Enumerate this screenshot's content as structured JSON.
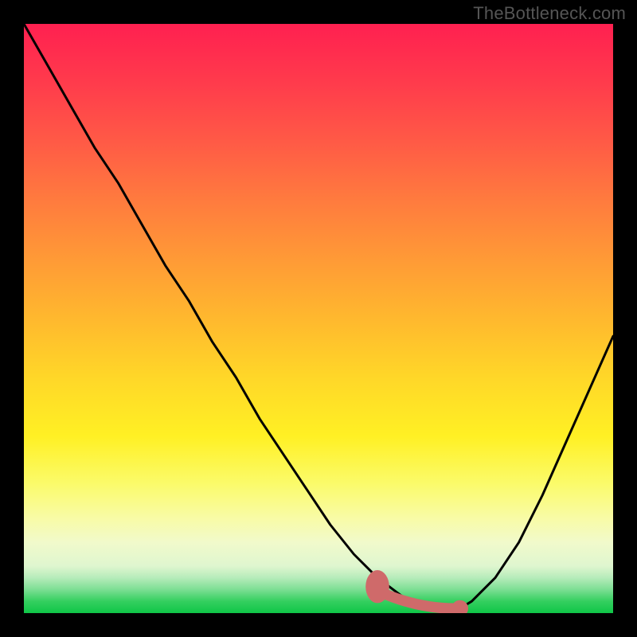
{
  "watermark": "TheBottleneck.com",
  "chart_data": {
    "type": "line",
    "title": "",
    "xlabel": "",
    "ylabel": "",
    "xlim": [
      0,
      100
    ],
    "ylim": [
      0,
      100
    ],
    "grid": false,
    "legend": false,
    "series": [
      {
        "name": "bottleneck-curve",
        "color": "#000000",
        "x": [
          0,
          4,
          8,
          12,
          16,
          20,
          24,
          28,
          32,
          36,
          40,
          44,
          48,
          52,
          56,
          58,
          60,
          62,
          64,
          66,
          68,
          70,
          72,
          74,
          76,
          80,
          84,
          88,
          92,
          96,
          100
        ],
        "y": [
          100,
          93,
          86,
          79,
          73,
          66,
          59,
          53,
          46,
          40,
          33,
          27,
          21,
          15,
          10,
          8,
          6,
          4.5,
          3,
          2,
          1.2,
          0.8,
          0.6,
          0.8,
          2,
          6,
          12,
          20,
          29,
          38,
          47
        ]
      }
    ],
    "markers": [
      {
        "name": "flat-zone-start",
        "shape": "rounded",
        "color": "#cf6a6a",
        "x": 60,
        "y": 4.5,
        "rx": 2.0,
        "ry": 2.8
      },
      {
        "name": "flat-zone-end",
        "shape": "circle",
        "color": "#cf6a6a",
        "x": 74,
        "y": 0.8,
        "r": 1.4
      }
    ],
    "flat_band": {
      "color": "#cf6a6a",
      "x_from": 60,
      "x_to": 74,
      "y": 0.8,
      "thickness": 0.9
    }
  }
}
